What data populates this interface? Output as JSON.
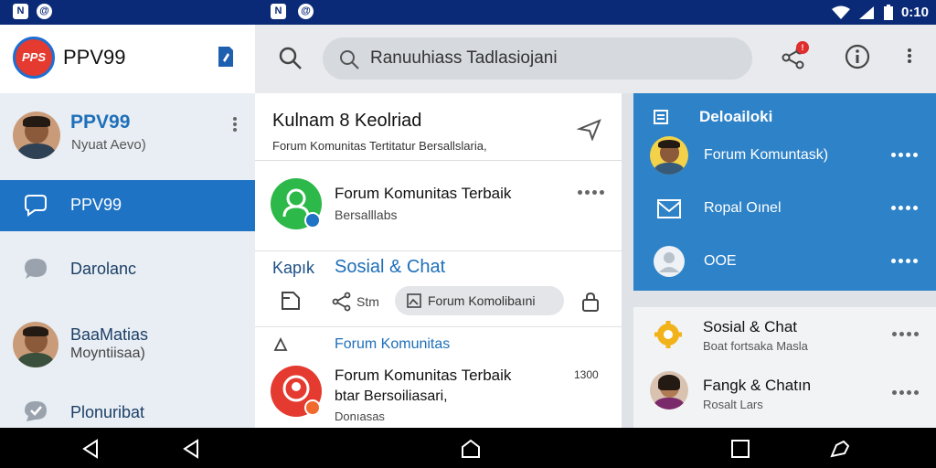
{
  "status_bar": {
    "left_icons": [
      "notification-a-icon",
      "notification-b-icon"
    ],
    "center_icons": [
      "notification-a-icon",
      "notification-b-icon"
    ],
    "time": "0:10"
  },
  "sidebar": {
    "brand": {
      "logo_text": "PPS",
      "title": "PPV99"
    },
    "profile": {
      "name": "PPV99",
      "subtitle": "Nyuat Aevo)"
    },
    "items": [
      {
        "label": "PPV99",
        "icon": "chat-bubble-icon",
        "active": true
      },
      {
        "label": "Darolanc",
        "icon": "chat-icon",
        "active": false
      },
      {
        "label": "BaaMatias",
        "sublabel": "Moyntiisaa)",
        "icon": "avatar",
        "active": false
      },
      {
        "label": "Plonuribat",
        "icon": "check-chat-icon",
        "active": false
      }
    ]
  },
  "topbar": {
    "search_placeholder": "Ranuuhiass Tadlasiojani",
    "notification_badge": "!"
  },
  "main": {
    "header": {
      "title": "Kulnam 8 Keolriad",
      "subtitle": "Forum Komunitas Tertitatur Bersallslaria,"
    },
    "post1": {
      "title": "Forum Komunitas Terbaik",
      "subtitle": "Bersalllabs"
    },
    "section": {
      "left_label": "Kapık",
      "title": "Sosial & Chat",
      "share_label": "Stm",
      "pill_label": "Forum Komolibaıni"
    },
    "post2": {
      "header_label": "Forum Komunitas",
      "title": "Forum Komunitas Terbaik",
      "subtitle": "btar Bersoiliasari,",
      "extra": "Donıasas",
      "count": "1300"
    }
  },
  "right_panel": {
    "header": "Deloailoki",
    "items": [
      {
        "label": "Forum Komuntask)"
      },
      {
        "label": "Ropal Oınel"
      },
      {
        "label": "OOE"
      }
    ]
  },
  "right_list": {
    "items": [
      {
        "title": "Sosial & Chat",
        "subtitle": "Boat fortsaka Masla"
      },
      {
        "title": "Fangk & Chatın",
        "subtitle": "Rosalt Lars"
      }
    ]
  },
  "colors": {
    "status_bar": "#0a2a78",
    "accent_blue": "#1f73c4",
    "right_panel": "#2e82c8",
    "green": "#2db84a",
    "red": "#e43a2f"
  }
}
